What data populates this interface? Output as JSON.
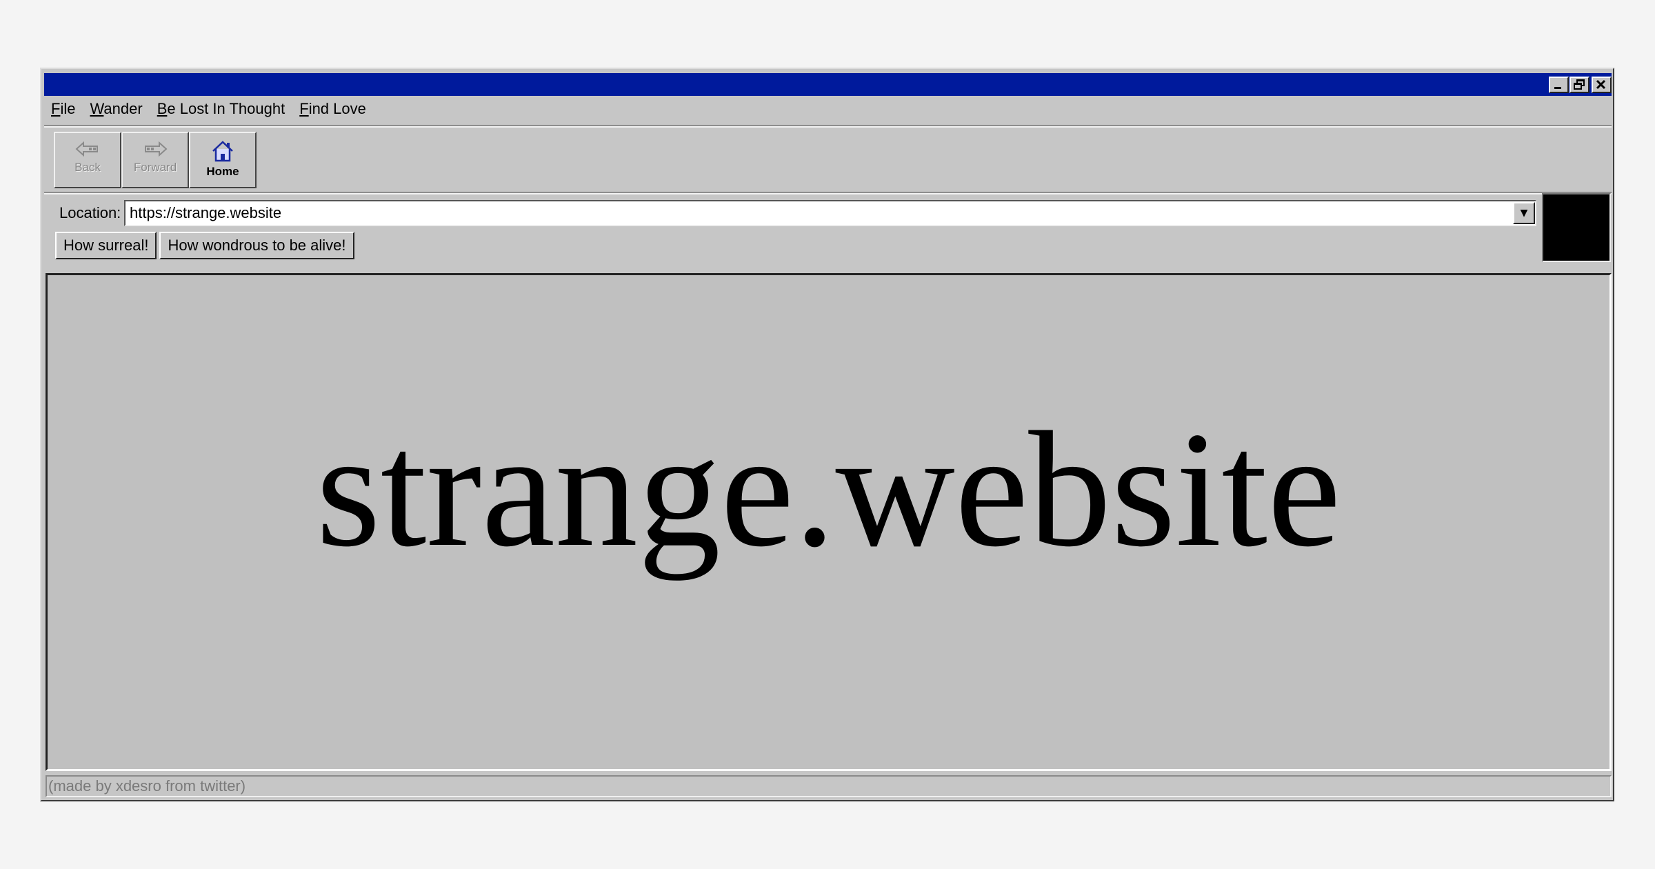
{
  "window": {
    "controls": [
      "minimize-icon",
      "restore-icon",
      "close-icon"
    ]
  },
  "menu": {
    "file": {
      "first": "F",
      "rest": "ile"
    },
    "wander": {
      "first": "W",
      "rest": "ander"
    },
    "lost": {
      "first": "B",
      "rest": "e Lost In Thought"
    },
    "love": {
      "first": "F",
      "rest": "ind Love"
    }
  },
  "toolbar": {
    "back": {
      "label": "Back",
      "icon": "back-arrow-icon",
      "enabled": false
    },
    "forward": {
      "label": "Forward",
      "icon": "forward-arrow-icon",
      "enabled": false
    },
    "home": {
      "label": "Home",
      "icon": "home-icon",
      "enabled": true
    }
  },
  "location": {
    "label": "Location:",
    "value": "https://strange.website"
  },
  "buttons": {
    "surreal": "How surreal!",
    "alive": "How wondrous to be alive!"
  },
  "content": {
    "headline": "strange.website"
  },
  "status": {
    "text": "(made by xdesro from twitter)"
  },
  "colors": {
    "titlebar": "#001a9c",
    "chrome": "#c6c6c6",
    "content_bg": "#c0c0c0",
    "page_bg": "#f4f4f4"
  }
}
